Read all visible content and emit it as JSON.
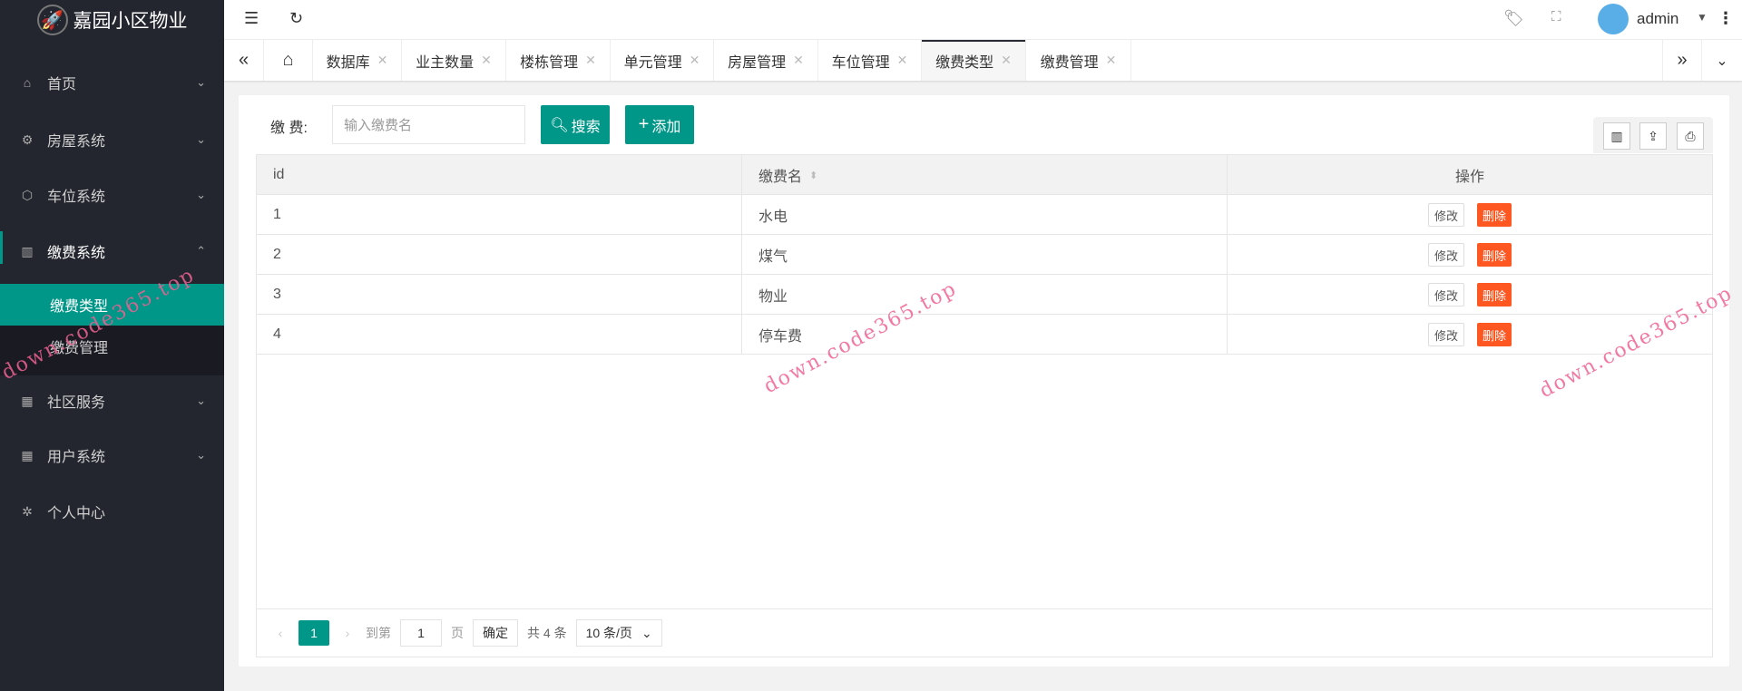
{
  "app": {
    "title": "嘉园小区物业",
    "user": "admin"
  },
  "sidebar": {
    "items": [
      {
        "label": "首页",
        "icon": "home-icon"
      },
      {
        "label": "房屋系统",
        "icon": "gear-icon"
      },
      {
        "label": "车位系统",
        "icon": "cube-icon"
      },
      {
        "label": "缴费系统",
        "icon": "template-icon"
      },
      {
        "label": "社区服务",
        "icon": "app-icon"
      },
      {
        "label": "用户系统",
        "icon": "app-icon"
      },
      {
        "label": "个人中心",
        "icon": "star-icon"
      }
    ],
    "sub": [
      "缴费类型",
      "缴费管理"
    ]
  },
  "tabs": [
    "数据库",
    "业主数量",
    "楼栋管理",
    "单元管理",
    "房屋管理",
    "车位管理",
    "缴费类型",
    "缴费管理"
  ],
  "filter": {
    "label": "缴 费:",
    "placeholder": "输入缴费名",
    "search": "搜索",
    "add": "添加"
  },
  "table": {
    "headers": [
      "id",
      "缴费名",
      "操作"
    ],
    "rows": [
      {
        "id": "1",
        "name": "水电"
      },
      {
        "id": "2",
        "name": "煤气"
      },
      {
        "id": "3",
        "name": "物业"
      },
      {
        "id": "4",
        "name": "停车费"
      }
    ],
    "edit": "修改",
    "delete": "删除"
  },
  "pager": {
    "current": "1",
    "goto": "到第",
    "page_value": "1",
    "page": "页",
    "confirm": "确定",
    "total": "共 4 条",
    "size": "10 条/页"
  },
  "watermark": "down.code365.top",
  "colors": {
    "accent": "#009688",
    "danger": "#ff5722",
    "sidebar": "#23262e"
  }
}
